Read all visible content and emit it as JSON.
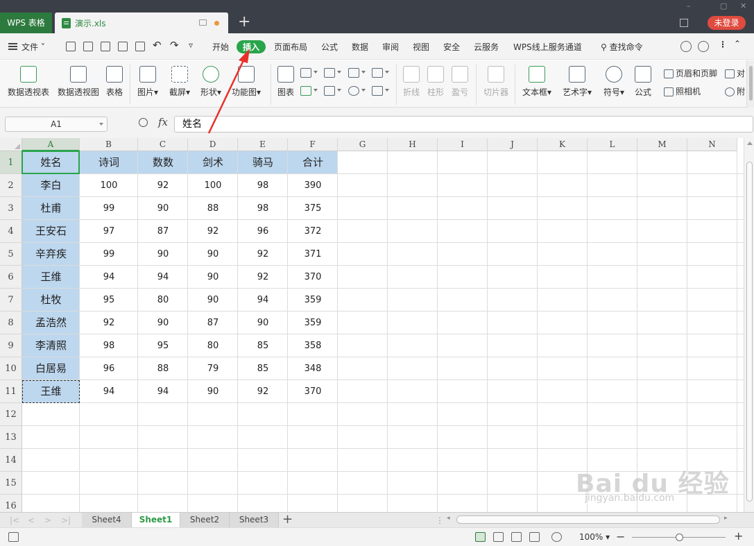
{
  "titlebar": {
    "app_tab": "WPS 表格",
    "doc_tab": "演示.xls",
    "login": "未登录"
  },
  "menubar": {
    "file": "文件",
    "items": [
      "开始",
      "插入",
      "页面布局",
      "公式",
      "数据",
      "审阅",
      "视图",
      "安全",
      "云服务",
      "WPS线上服务通道"
    ],
    "active": "插入",
    "search": "查找命令"
  },
  "ribbon": {
    "buttons": [
      "数据透视表",
      "数据透视图",
      "表格",
      "图片",
      "截屏",
      "形状",
      "功能图",
      "图表",
      "折线",
      "柱形",
      "盈亏",
      "切片器",
      "文本框",
      "艺术字",
      "符号",
      "公式"
    ],
    "right_items": [
      "页眉和页脚",
      "照相机",
      "对",
      "附"
    ]
  },
  "formulabar": {
    "namebox": "A1",
    "fx": "fx",
    "value": "姓名"
  },
  "grid": {
    "columns": [
      "A",
      "B",
      "C",
      "D",
      "E",
      "F",
      "G",
      "H",
      "I",
      "J",
      "K",
      "L",
      "M",
      "N"
    ],
    "rows": [
      "1",
      "2",
      "3",
      "4",
      "5",
      "6",
      "7",
      "8",
      "9",
      "10",
      "11",
      "12",
      "13",
      "14",
      "15",
      "16"
    ],
    "headers": [
      "姓名",
      "诗词",
      "数数",
      "剑术",
      "骑马",
      "合计"
    ],
    "data": [
      [
        "李白",
        "100",
        "92",
        "100",
        "98",
        "390"
      ],
      [
        "杜甫",
        "99",
        "90",
        "88",
        "98",
        "375"
      ],
      [
        "王安石",
        "97",
        "87",
        "92",
        "96",
        "372"
      ],
      [
        "辛弃疾",
        "99",
        "90",
        "90",
        "92",
        "371"
      ],
      [
        "王维",
        "94",
        "94",
        "90",
        "92",
        "370"
      ],
      [
        "杜牧",
        "95",
        "80",
        "90",
        "94",
        "359"
      ],
      [
        "孟浩然",
        "92",
        "90",
        "87",
        "90",
        "359"
      ],
      [
        "李清照",
        "98",
        "95",
        "80",
        "85",
        "358"
      ],
      [
        "白居易",
        "96",
        "88",
        "79",
        "85",
        "348"
      ],
      [
        "王维",
        "94",
        "94",
        "90",
        "92",
        "370"
      ]
    ]
  },
  "sheets": {
    "tabs": [
      "Sheet4",
      "Sheet1",
      "Sheet2",
      "Sheet3"
    ],
    "active": "Sheet1"
  },
  "status": {
    "zoom": "100%"
  },
  "watermark": {
    "brand": "Bai du 经验",
    "url": "jingyan.baidu.com"
  },
  "colors": {
    "accent": "#2aa44b",
    "header_fill": "#bdd7ee",
    "titlebar": "#3b3f48",
    "annotation": "#e8302a"
  }
}
